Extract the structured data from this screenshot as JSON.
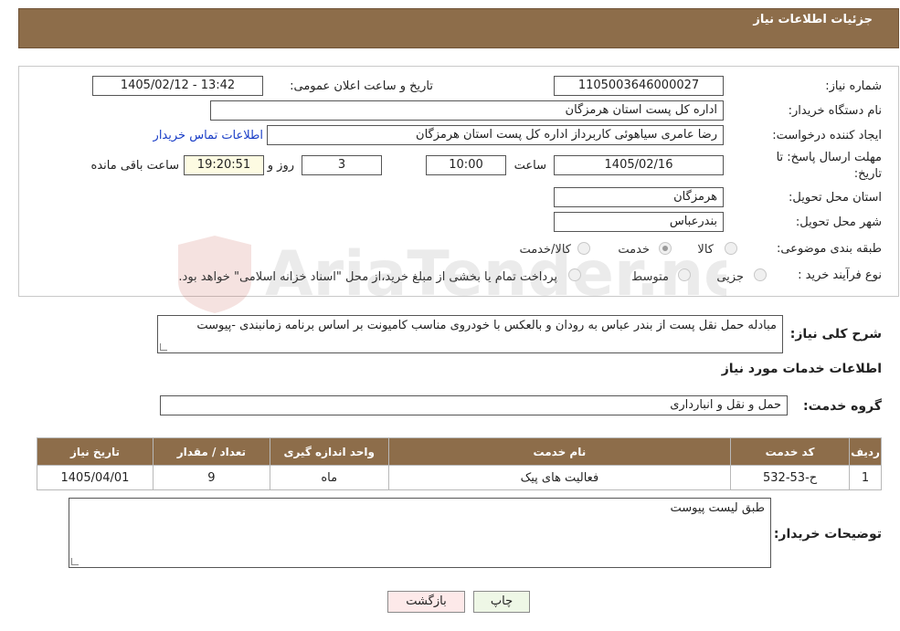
{
  "header": {
    "title": "جزئیات اطلاعات نیاز"
  },
  "fields": {
    "need_number_label": "شماره نیاز:",
    "need_number": "1105003646000027",
    "announce_datetime_label": "تاریخ و ساعت اعلان عمومی:",
    "announce_datetime": "1405/02/12 - 13:42",
    "buyer_org_label": "نام دستگاه خریدار:",
    "buyer_org": "اداره کل پست استان هرمزگان",
    "requester_label": "ایجاد کننده درخواست:",
    "requester": "رضا عامری سیاهوئی کاربرداز اداره کل پست استان هرمزگان",
    "contact_link": "اطلاعات تماس خریدار",
    "deadline_label_1": "مهلت ارسال پاسخ: تا",
    "deadline_label_2": "تاریخ:",
    "deadline_date": "1405/02/16",
    "time_label": "ساعت",
    "deadline_time": "10:00",
    "days_value": "3",
    "days_label": "روز و",
    "remaining_time": "19:20:51",
    "remaining_label": "ساعت باقی مانده",
    "province_label": "استان محل تحویل:",
    "province": "هرمزگان",
    "city_label": "شهر محل تحویل:",
    "city": "بندرعباس",
    "category_label": "طبقه بندی موضوعی:",
    "category_options": [
      "کالا",
      "خدمت",
      "کالا/خدمت"
    ],
    "category_selected": "خدمت",
    "process_label": "نوع فرآیند خرید :",
    "process_options": [
      "جزیی",
      "متوسط"
    ],
    "process_note": "پرداخت تمام یا بخشی از مبلغ خرید،از محل \"اسناد خزانه اسلامی\" خواهد بود."
  },
  "description": {
    "label": "شرح کلی نیاز:",
    "text": "مبادله حمل نقل پست از بندر عباس به رودان و بالعکس با خودروی مناسب کامیونت بر اساس برنامه زمانبندی -پیوست"
  },
  "services_section": {
    "title": "اطلاعات خدمات مورد نیاز",
    "group_label": "گروه خدمت:",
    "group_value": "حمل و نقل و انبارداری"
  },
  "table": {
    "headers": [
      "ردیف",
      "کد خدمت",
      "نام خدمت",
      "واحد اندازه گیری",
      "تعداد / مقدار",
      "تاریخ نیاز"
    ],
    "rows": [
      [
        "1",
        "ح-53-532",
        "فعالیت های پیک",
        "ماه",
        "9",
        "1405/04/01"
      ]
    ]
  },
  "buyer_notes": {
    "label": "توضیحات خریدار:",
    "text": "طبق لیست پیوست"
  },
  "buttons": {
    "print": "چاپ",
    "back": "بازگشت"
  },
  "watermark": {
    "text": "AriaTender.neT"
  },
  "colors": {
    "header_bg": "#8d6d4a",
    "link": "#1a3ec7",
    "back_button": "#fde9e9",
    "print_button": "#eef7e6"
  }
}
